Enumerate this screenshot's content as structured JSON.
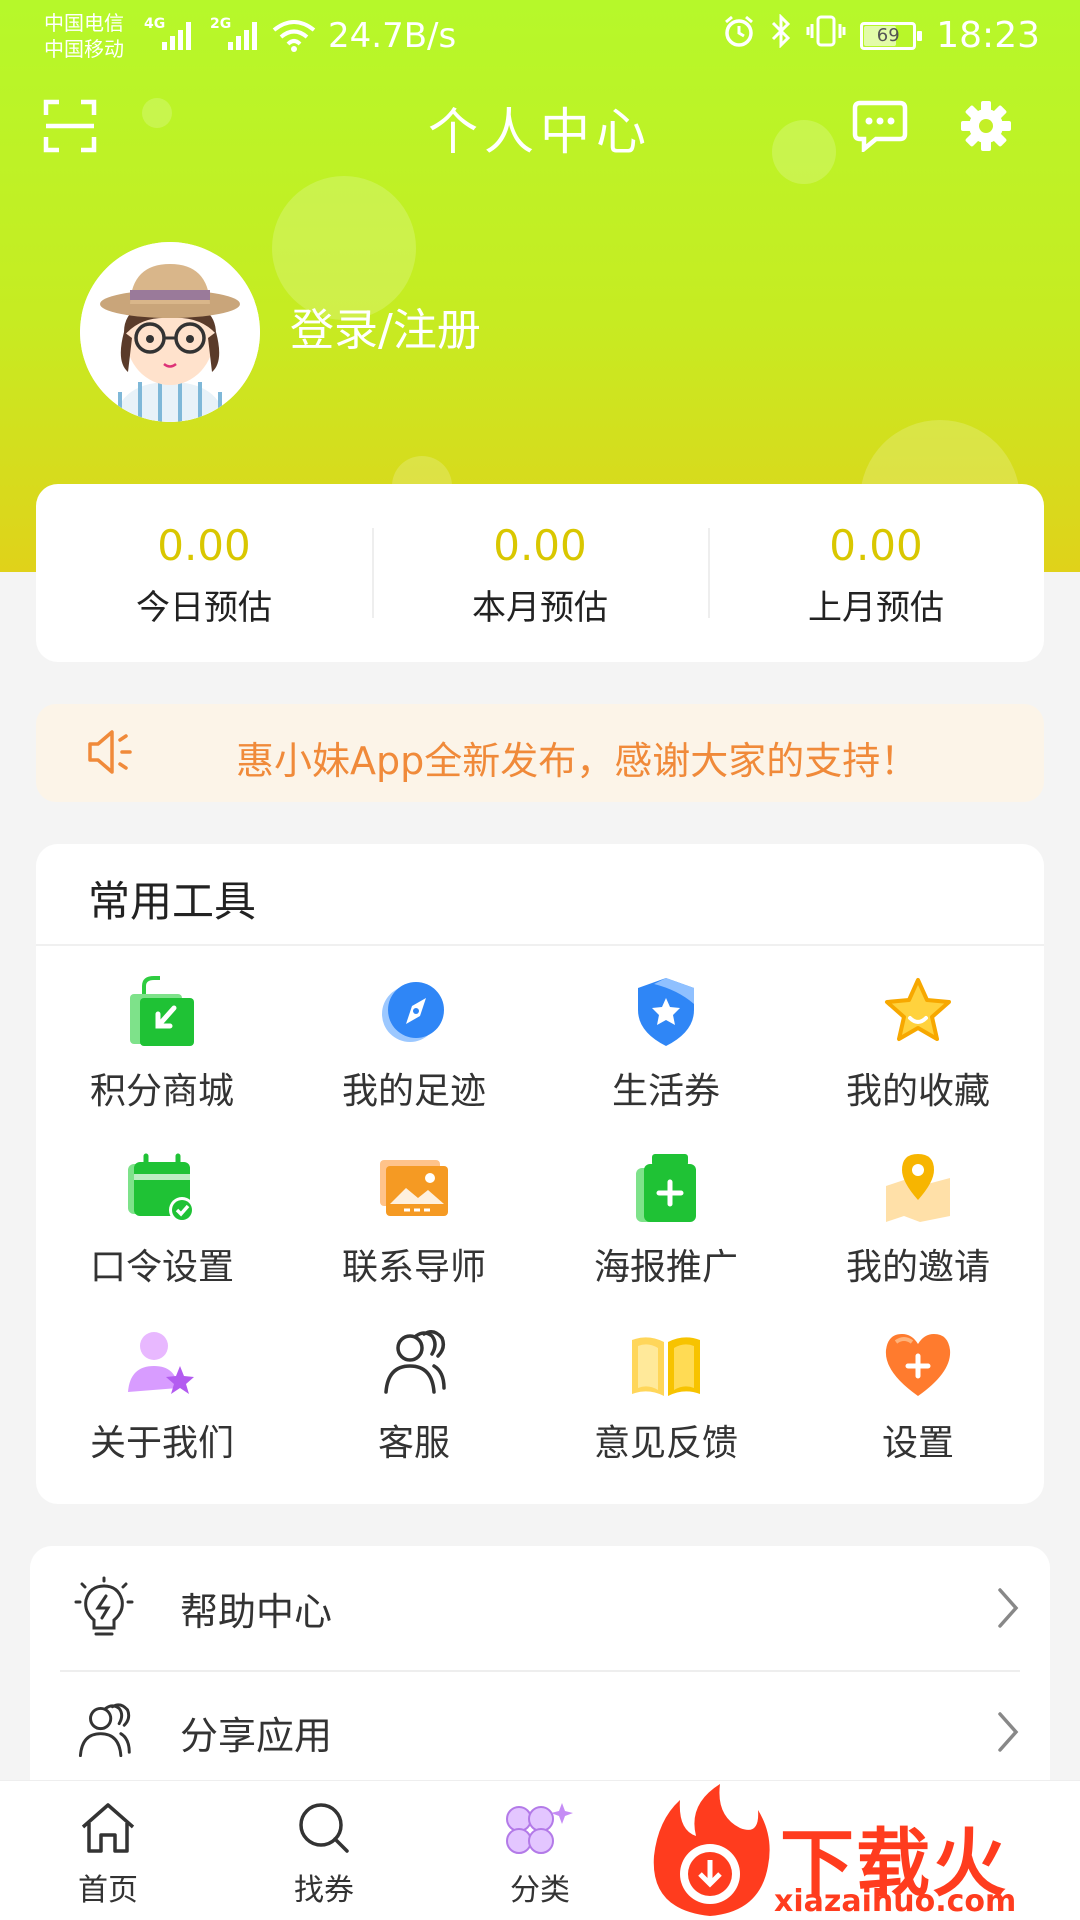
{
  "status_bar": {
    "carrier1": "中国电信",
    "carrier2": "中国移动",
    "net1": "4G",
    "net2": "2G",
    "speed": "24.7B/s",
    "battery": "69",
    "time": "18:23"
  },
  "header": {
    "title": "个人中心",
    "login_text": "登录/注册"
  },
  "earnings": [
    {
      "value": "0.00",
      "label": "今日预估"
    },
    {
      "value": "0.00",
      "label": "本月预估"
    },
    {
      "value": "0.00",
      "label": "上月预估"
    }
  ],
  "notice": {
    "text": "惠小妹App全新发布，感谢大家的支持！"
  },
  "tools": {
    "title": "常用工具",
    "items": [
      {
        "label": "积分商城",
        "icon": "shopping-bag-icon",
        "color": "#2ecc40"
      },
      {
        "label": "我的足迹",
        "icon": "compass-icon",
        "color": "#2f86f6"
      },
      {
        "label": "生活券",
        "icon": "shield-star-icon",
        "color": "#2f86f6"
      },
      {
        "label": "我的收藏",
        "icon": "star-icon",
        "color": "#f7b500"
      },
      {
        "label": "口令设置",
        "icon": "calendar-check-icon",
        "color": "#2ecc40"
      },
      {
        "label": "联系导师",
        "icon": "picture-icon",
        "color": "#f59a23"
      },
      {
        "label": "海报推广",
        "icon": "medicine-bottle-icon",
        "color": "#2ecc40"
      },
      {
        "label": "我的邀请",
        "icon": "map-pin-icon",
        "color": "#f7b500"
      },
      {
        "label": "关于我们",
        "icon": "user-star-icon",
        "color": "#c77dff"
      },
      {
        "label": "客服",
        "icon": "people-outline-icon",
        "color": "#333333"
      },
      {
        "label": "意见反馈",
        "icon": "book-icon",
        "color": "#f7c300"
      },
      {
        "label": "设置",
        "icon": "heart-plus-icon",
        "color": "#ff7b2e"
      }
    ]
  },
  "list": [
    {
      "label": "帮助中心",
      "icon": "lightbulb-icon"
    },
    {
      "label": "分享应用",
      "icon": "people-outline-icon"
    }
  ],
  "bottom_nav": [
    {
      "label": "首页",
      "icon": "home-icon"
    },
    {
      "label": "找券",
      "icon": "search-icon"
    },
    {
      "label": "分类",
      "icon": "category-clover-icon"
    }
  ],
  "watermark": {
    "text": "下载火",
    "url": "xiazaihuo.com"
  },
  "colors": {
    "header_top": "#b6f82a",
    "header_bottom": "#e0d21a",
    "earn_value": "#d9c700",
    "notice_text": "#f08a3a",
    "notice_bg": "#fcf4e8"
  }
}
